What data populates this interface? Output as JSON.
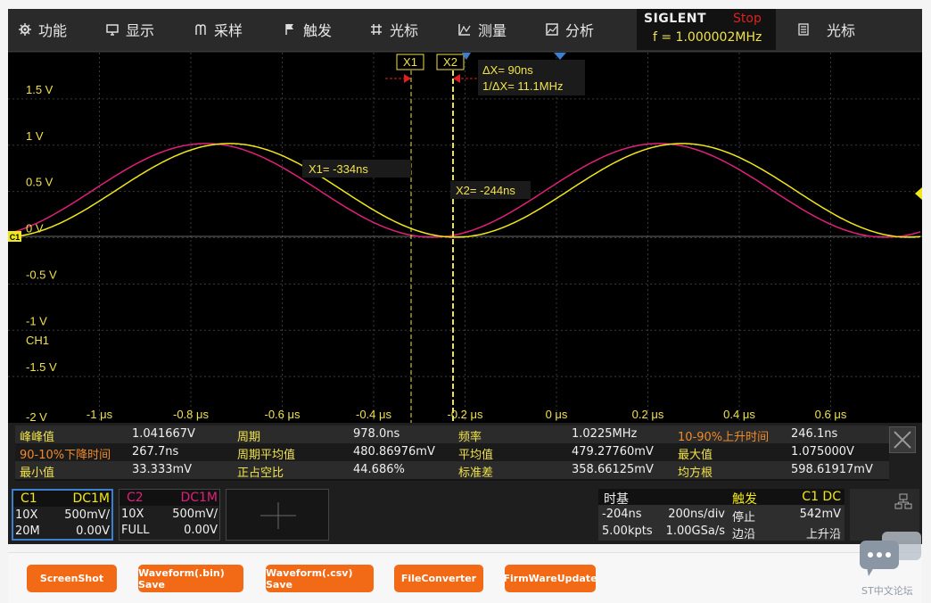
{
  "menu": [
    {
      "label": "功能",
      "icon": "gear-icon"
    },
    {
      "label": "显示",
      "icon": "monitor-icon"
    },
    {
      "label": "采样",
      "icon": "sample-icon"
    },
    {
      "label": "触发",
      "icon": "flag-icon"
    },
    {
      "label": "光标",
      "icon": "cursor-grid-icon"
    },
    {
      "label": "测量",
      "icon": "measure-icon"
    },
    {
      "label": "分析",
      "icon": "analysis-icon"
    }
  ],
  "brand": {
    "name": "SIGLENT",
    "state": "Stop",
    "freq": "f = 1.000002MHz"
  },
  "right_menu": {
    "label": "光标",
    "icon": "list-icon"
  },
  "plot": {
    "y_labels": [
      "1.5 V",
      "1 V",
      "0.5 V",
      "0 V",
      "-0.5 V",
      "-1 V",
      "-1.5 V",
      "-2 V"
    ],
    "x_labels": [
      "-1 μs",
      "-0.8 μs",
      "-0.6 μs",
      "-0.4 μs",
      "-0.2 μs",
      "0 μs",
      "0.2 μs",
      "0.4 μs",
      "0.6 μs"
    ],
    "ch_label": "CH1",
    "ch_marker": "C1",
    "cursor_x1": {
      "tag": "X1",
      "readout": "X1= -334ns"
    },
    "cursor_x2": {
      "tag": "X2",
      "readout": "X2= -244ns"
    },
    "delta_x": "ΔX= 90ns",
    "inv_delta_x": "1/ΔX= 11.1MHz",
    "colors": {
      "ch1": "#f0e818",
      "ch2": "#e0207a",
      "cursor": "#f0e24a",
      "grid": "#3a3a3a"
    }
  },
  "measurements": [
    [
      {
        "label": "峰峰值",
        "value": "1.041667V"
      },
      {
        "label": "周期",
        "value": "978.0ns"
      },
      {
        "label": "频率",
        "value": "1.0225MHz"
      },
      {
        "label": "10-90%上升时间",
        "value": "246.1ns",
        "warn": true
      }
    ],
    [
      {
        "label": "90-10%下降时间",
        "value": "267.7ns",
        "warn": true
      },
      {
        "label": "周期平均值",
        "value": "480.86976mV"
      },
      {
        "label": "平均值",
        "value": "479.27760mV"
      },
      {
        "label": "最大值",
        "value": "1.075000V"
      }
    ],
    [
      {
        "label": "最小值",
        "value": "33.333mV"
      },
      {
        "label": "正占空比",
        "value": "44.686%"
      },
      {
        "label": "标准差",
        "value": "358.66125mV"
      },
      {
        "label": "均方根",
        "value": "598.61917mV"
      }
    ]
  ],
  "ch1": {
    "name": "C1",
    "coupling": "DC1M",
    "probe": "10X",
    "scale": "500mV/",
    "bw": "20M",
    "offset": "0.00V"
  },
  "ch2": {
    "name": "C2",
    "coupling": "DC1M",
    "probe": "10X",
    "scale": "500mV/",
    "bw": "FULL",
    "offset": "0.00V"
  },
  "timebase": {
    "title": "时基",
    "delay": "-204ns",
    "scale": "200ns/div",
    "points": "5.00kpts",
    "rate": "1.00GSa/s"
  },
  "trigger": {
    "title": "触发",
    "source": "C1 DC",
    "state": "停止",
    "level": "542mV",
    "edge_label": "边沿",
    "slope": "上升沿"
  },
  "buttons": [
    "ScreenShot",
    "Waveform(.bin) Save",
    "Waveform(.csv) Save",
    "FileConverter",
    "FirmWareUpdate"
  ],
  "forum": "ST中文论坛"
}
